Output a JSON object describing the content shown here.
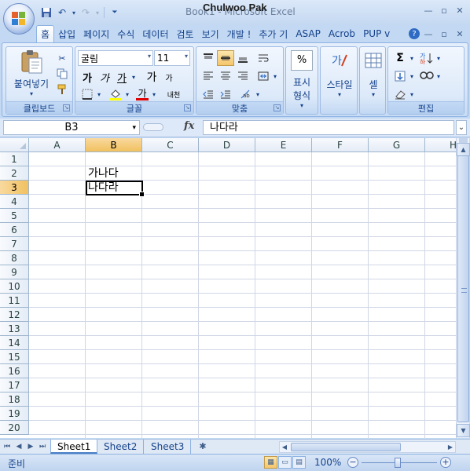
{
  "window": {
    "title": "Book1 - Microsoft Excel",
    "overlay_name": "Chulwoo Pak"
  },
  "quick_access": {
    "save_icon": "save-icon",
    "undo_icon": "undo-icon",
    "redo_icon": "redo-icon",
    "customize_icon": "customize-qat-icon"
  },
  "ribbon_tabs": [
    "홈",
    "삽입",
    "페이지",
    "수식",
    "데이터",
    "검토",
    "보기",
    "개발 !",
    "추가 기",
    "ASAP",
    "Acrob",
    "PUP v"
  ],
  "ribbon": {
    "clipboard": {
      "paste_label": "붙여넣기",
      "group_label": "클립보드"
    },
    "font": {
      "font_name": "굴림",
      "font_size": "11",
      "bold": "가",
      "italic": "가",
      "underline": "가",
      "grow": "가",
      "shrink": "가",
      "font_color_glyph": "가",
      "phonetic": "내천",
      "group_label": "글꼴"
    },
    "alignment": {
      "group_label": "맞춤"
    },
    "number": {
      "format_label": "표시\n형식",
      "format_line1": "표시",
      "format_line2": "형식",
      "percent": "%"
    },
    "styles": {
      "label": "스타일"
    },
    "cells": {
      "label": "셀"
    },
    "editing": {
      "group_label": "편집",
      "sum": "Σ"
    }
  },
  "formula_bar": {
    "name_box": "B3",
    "fx": "fx",
    "content": "나다라"
  },
  "columns": [
    "A",
    "B",
    "C",
    "D",
    "E",
    "F",
    "G",
    "H"
  ],
  "rows": [
    "1",
    "2",
    "3",
    "4",
    "5",
    "6",
    "7",
    "8",
    "9",
    "10",
    "11",
    "12",
    "13",
    "14",
    "15",
    "16",
    "17",
    "18",
    "19",
    "20"
  ],
  "cells": {
    "B2": "가나다",
    "B3": "나다라"
  },
  "selected": {
    "col": "B",
    "row": "3"
  },
  "sheets": [
    "Sheet1",
    "Sheet2",
    "Sheet3"
  ],
  "active_sheet": "Sheet1",
  "status": {
    "ready": "준비",
    "zoom": "100%"
  }
}
